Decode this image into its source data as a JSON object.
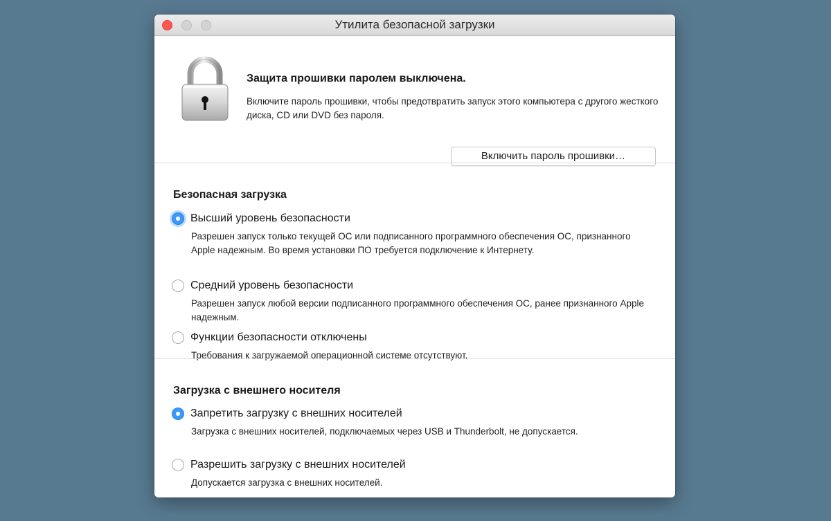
{
  "window": {
    "title": "Утилита безопасной загрузки"
  },
  "firmware": {
    "icon": "padlock-icon",
    "title": "Защита прошивки паролем выключена.",
    "description": "Включите пароль прошивки, чтобы предотвратить запуск этого компьютера с другого жесткого диска, CD или DVD без пароля.",
    "button_label": "Включить пароль прошивки…"
  },
  "secure_boot": {
    "title": "Безопасная загрузка",
    "options": [
      {
        "label": "Высший уровень безопасности",
        "description": "Разрешен запуск только текущей ОС или подписанного программного обеспечения ОС, признанного Apple надежным. Во время установки ПО требуется подключение к Интернету.",
        "selected": true
      },
      {
        "label": "Средний уровень безопасности",
        "description": "Разрешен запуск любой версии подписанного программного обеспечения ОС, ранее признанного Apple надежным.",
        "selected": false
      },
      {
        "label": "Функции безопасности отключены",
        "description": "Требования к загружаемой операционной системе отсутствуют.",
        "selected": false
      }
    ]
  },
  "external_boot": {
    "title": "Загрузка с внешнего носителя",
    "options": [
      {
        "label": "Запретить загрузку с внешних носителей",
        "description": "Загрузка с внешних носителей, подключаемых через USB и Thunderbolt, не допускается.",
        "selected": true
      },
      {
        "label": "Разрешить загрузку с внешних носителей",
        "description": "Допускается загрузка с внешних носителей.",
        "selected": false
      }
    ]
  },
  "colors": {
    "desktop_background": "#587a90",
    "accent": "#3b99fc",
    "close_button": "#fc5753"
  }
}
